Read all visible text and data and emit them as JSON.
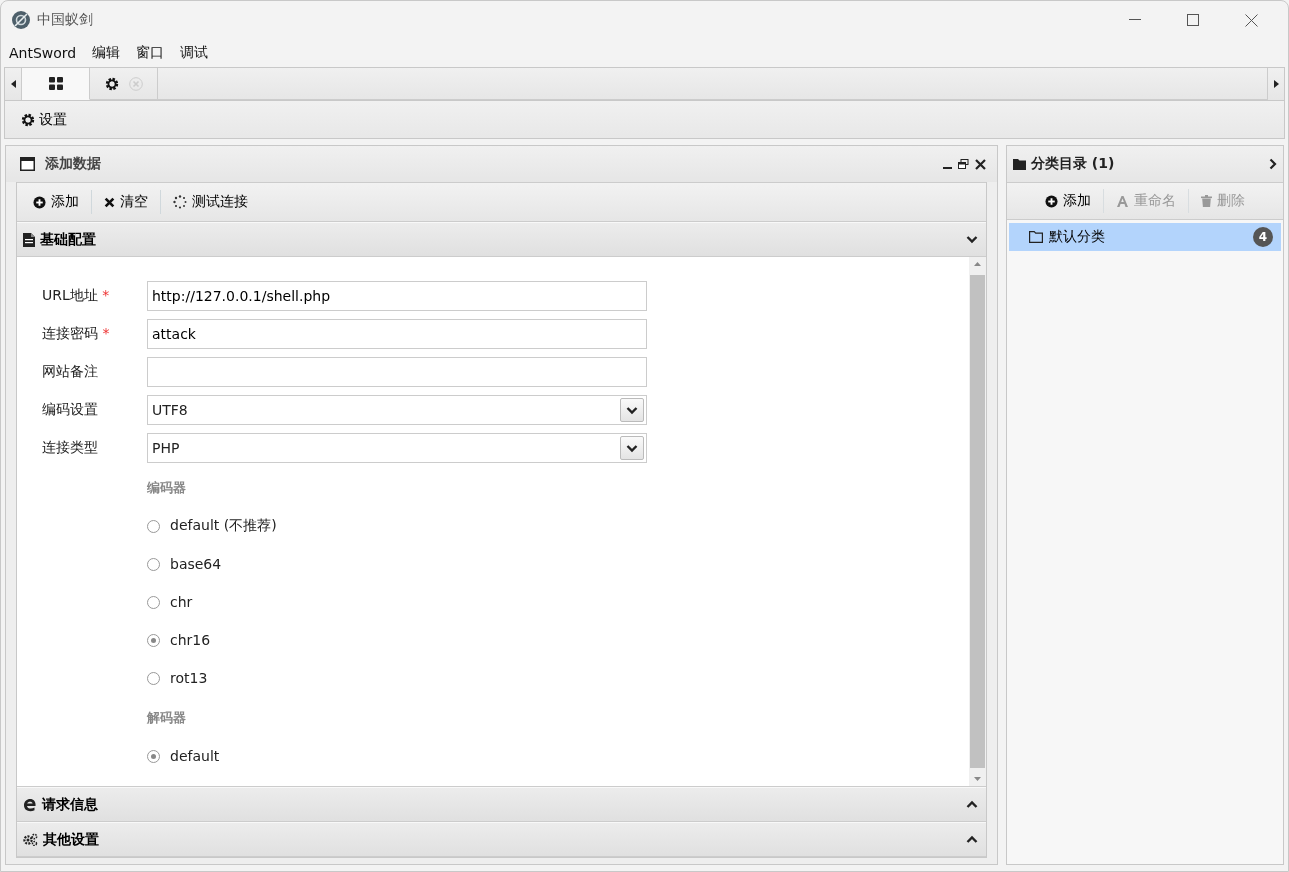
{
  "window": {
    "title": "中国蚁剑"
  },
  "menu": [
    "AntSword",
    "编辑",
    "窗口",
    "调试"
  ],
  "tabs": [
    {
      "kind": "home",
      "selected": true,
      "closable": false
    },
    {
      "kind": "settings",
      "selected": false,
      "closable": true
    }
  ],
  "toolbar": {
    "settings_button": "设置"
  },
  "add_panel": {
    "title": "添加数据",
    "toolbar": [
      {
        "label": "添加",
        "kind": "add"
      },
      {
        "label": "清空",
        "kind": "clear"
      },
      {
        "label": "测试连接",
        "kind": "test"
      }
    ],
    "sections": [
      {
        "title": "基础配置",
        "kind": "doc",
        "expanded": true,
        "fields": [
          {
            "label": "URL地址",
            "required_mark": "*",
            "kind": "text",
            "value": "http://127.0.0.1/shell.php"
          },
          {
            "label": "连接密码",
            "required_mark": "*",
            "kind": "text",
            "value": "attack"
          },
          {
            "label": "网站备注",
            "kind": "text"
          },
          {
            "label": "编码设置",
            "kind": "select",
            "value": "UTF8"
          },
          {
            "label": "连接类型",
            "kind": "select",
            "value": "PHP"
          }
        ],
        "groups": [
          {
            "title": "编码器",
            "options": [
              {
                "label": "default (不推荐)",
                "selected": false
              },
              {
                "label": "base64",
                "selected": false
              },
              {
                "label": "chr",
                "selected": false
              },
              {
                "label": "chr16",
                "selected": true
              },
              {
                "label": "rot13",
                "selected": false
              }
            ]
          },
          {
            "title": "解码器",
            "options": [
              {
                "label": "default",
                "selected": true
              }
            ]
          }
        ]
      },
      {
        "title": "请求信息",
        "kind": "edge",
        "expanded": false
      },
      {
        "title": "其他设置",
        "kind": "gears",
        "expanded": false
      }
    ]
  },
  "category_panel": {
    "title": "分类目录 (1)",
    "toolbar": [
      {
        "label": "添加",
        "kind": "add",
        "disabled": false
      },
      {
        "label": "重命名",
        "kind": "rename",
        "disabled": true
      },
      {
        "label": "删除",
        "kind": "delete",
        "disabled": true
      }
    ],
    "items": [
      {
        "label": "默认分类",
        "count": "4",
        "selected": true
      }
    ]
  }
}
